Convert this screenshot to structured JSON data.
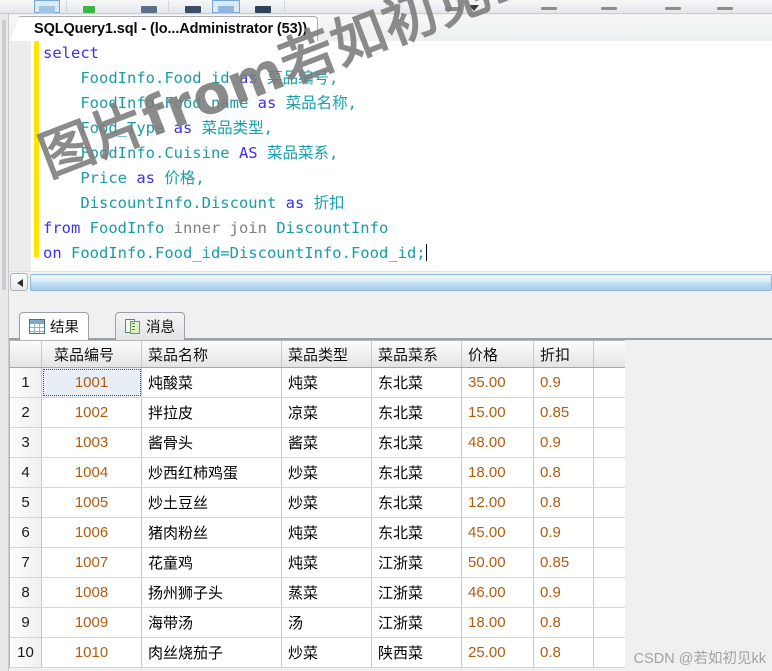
{
  "window": {
    "document_tab": "SQLQuery1.sql - (lo...Administrator (53))"
  },
  "toolbar": {
    "buttons": [
      {
        "name": "new-query",
        "color": "#9fc4e8",
        "selected": true
      },
      {
        "name": "execute",
        "color": "#3ab54a",
        "selected": false
      },
      {
        "name": "parse",
        "color": "#5b6f85",
        "selected": false
      },
      {
        "name": "include-plan",
        "color": "#3a4f66",
        "selected": false
      },
      {
        "name": "display-plan",
        "color": "#8fb6de",
        "selected": true
      },
      {
        "name": "client-statistics",
        "color": "#2f4258",
        "selected": false
      },
      {
        "name": "results-to-grid",
        "color": "#8d8d8d",
        "selected": false
      },
      {
        "name": "results-to-text",
        "color": "#8d8d8d",
        "selected": false
      },
      {
        "name": "results-to-file",
        "color": "#8d8d8d",
        "selected": false
      },
      {
        "name": "comment-lines",
        "color": "#8d8d8d",
        "selected": false
      }
    ]
  },
  "editor": {
    "lines": [
      [
        {
          "t": "select",
          "c": "kw"
        }
      ],
      [
        {
          "t": "    FoodInfo.Food_id ",
          "c": "id"
        },
        {
          "t": "as",
          "c": "kw"
        },
        {
          "t": " 菜品编号,",
          "c": "cn"
        }
      ],
      [
        {
          "t": "    FoodInfo.Food_name ",
          "c": "id"
        },
        {
          "t": "as",
          "c": "kw"
        },
        {
          "t": " 菜品名称,",
          "c": "cn"
        }
      ],
      [
        {
          "t": "    Food_Type ",
          "c": "id"
        },
        {
          "t": "as",
          "c": "kw"
        },
        {
          "t": " 菜品类型,",
          "c": "cn"
        }
      ],
      [
        {
          "t": "    FoodInfo.Cuisine ",
          "c": "id"
        },
        {
          "t": "AS",
          "c": "kw"
        },
        {
          "t": " 菜品菜系,",
          "c": "cn"
        }
      ],
      [
        {
          "t": "    Price ",
          "c": "id"
        },
        {
          "t": "as",
          "c": "kw"
        },
        {
          "t": " 价格,",
          "c": "cn"
        }
      ],
      [
        {
          "t": "    DiscountInfo.Discount ",
          "c": "id"
        },
        {
          "t": "as",
          "c": "kw"
        },
        {
          "t": " 折扣",
          "c": "cn"
        }
      ],
      [
        {
          "t": "from",
          "c": "kw"
        },
        {
          "t": " FoodInfo ",
          "c": "id"
        },
        {
          "t": "inner join",
          "c": "op"
        },
        {
          "t": " DiscountInfo",
          "c": "id"
        }
      ],
      [
        {
          "t": "on",
          "c": "kw"
        },
        {
          "t": " FoodInfo.Food_id=DiscountInfo.Food_id;",
          "c": "id"
        }
      ]
    ]
  },
  "results_tabs": [
    {
      "label": "结果",
      "icon": "grid-icon",
      "active": true
    },
    {
      "label": "消息",
      "icon": "messages-icon",
      "active": false
    }
  ],
  "grid": {
    "columns": [
      "",
      "菜品编号",
      "菜品名称",
      "菜品类型",
      "菜品菜系",
      "价格",
      "折扣"
    ],
    "rows": [
      {
        "n": "1",
        "id": "1001",
        "name": "炖酸菜",
        "type": "炖菜",
        "cuisine": "东北菜",
        "price": "35.00",
        "discount": "0.9"
      },
      {
        "n": "2",
        "id": "1002",
        "name": "拌拉皮",
        "type": "凉菜",
        "cuisine": "东北菜",
        "price": "15.00",
        "discount": "0.85"
      },
      {
        "n": "3",
        "id": "1003",
        "name": "酱骨头",
        "type": "酱菜",
        "cuisine": "东北菜",
        "price": "48.00",
        "discount": "0.9"
      },
      {
        "n": "4",
        "id": "1004",
        "name": "炒西红柿鸡蛋",
        "type": "炒菜",
        "cuisine": "东北菜",
        "price": "18.00",
        "discount": "0.8"
      },
      {
        "n": "5",
        "id": "1005",
        "name": "炒土豆丝",
        "type": "炒菜",
        "cuisine": "东北菜",
        "price": "12.00",
        "discount": "0.8"
      },
      {
        "n": "6",
        "id": "1006",
        "name": "猪肉粉丝",
        "type": "炖菜",
        "cuisine": "东北菜",
        "price": "45.00",
        "discount": "0.9"
      },
      {
        "n": "7",
        "id": "1007",
        "name": "花童鸡",
        "type": "炖菜",
        "cuisine": "江浙菜",
        "price": "50.00",
        "discount": "0.85"
      },
      {
        "n": "8",
        "id": "1008",
        "name": "扬州狮子头",
        "type": "蒸菜",
        "cuisine": "江浙菜",
        "price": "46.00",
        "discount": "0.9"
      },
      {
        "n": "9",
        "id": "1009",
        "name": "海带汤",
        "type": "汤",
        "cuisine": "江浙菜",
        "price": "18.00",
        "discount": "0.8"
      },
      {
        "n": "10",
        "id": "1010",
        "name": "肉丝烧茄子",
        "type": "炒菜",
        "cuisine": "陕西菜",
        "price": "25.00",
        "discount": "0.8"
      }
    ],
    "selected_cell": {
      "row": 0,
      "column": "菜品编号"
    }
  },
  "watermarks": {
    "main": "图片from若如初见KK CSDN",
    "bottom": "CSDN @若如初见kk"
  },
  "colors": {
    "keyword": "#3b2ff5",
    "identifier": "#1a9ba6",
    "operator": "#808080",
    "number": "#b05d10",
    "change_bar": "#ffe400",
    "selection": "#e7eef5"
  }
}
